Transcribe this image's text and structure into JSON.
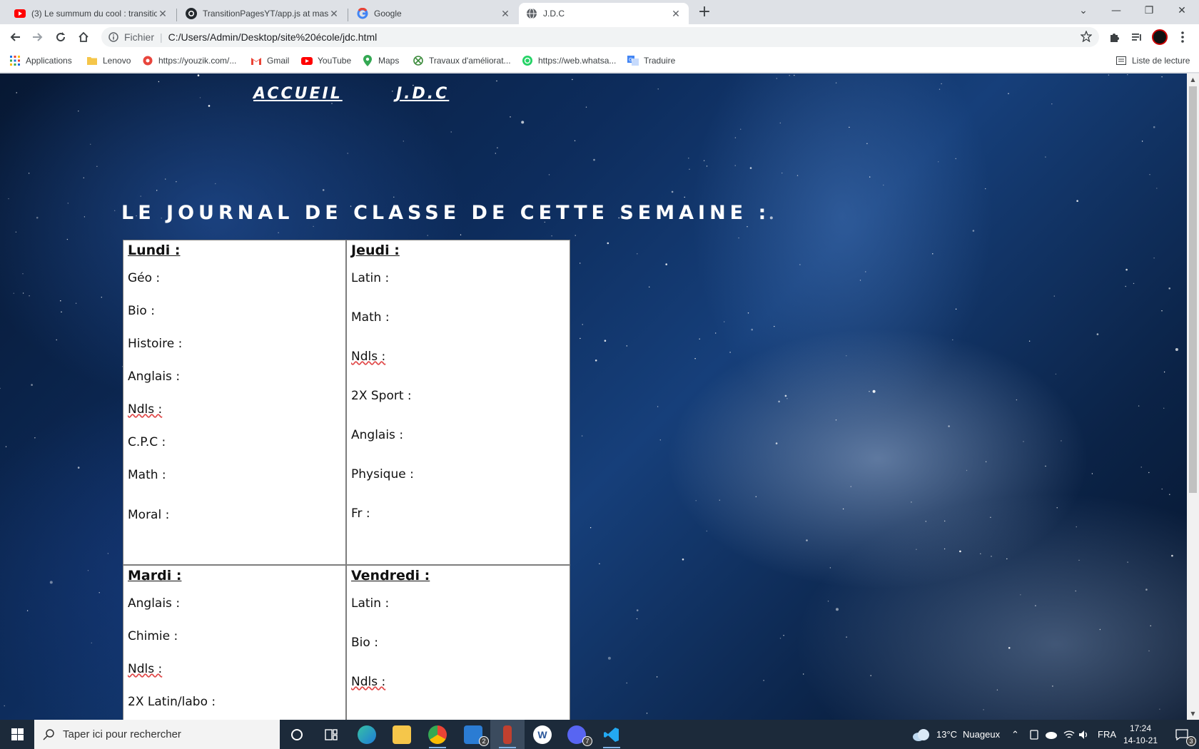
{
  "browser": {
    "tabs": [
      {
        "title": "(3) Le summum du cool : transitio",
        "favicon": "youtube-icon",
        "color": "#ff0000",
        "active": false
      },
      {
        "title": "TransitionPagesYT/app.js at mast",
        "favicon": "github-icon",
        "color": "#24292e",
        "active": false
      },
      {
        "title": "Google",
        "favicon": "google-icon",
        "color": "#4285f4",
        "active": false
      },
      {
        "title": "J.D.C",
        "favicon": "globe-icon",
        "color": "#5f6368",
        "active": true
      }
    ],
    "address": {
      "scheme_label": "Fichier",
      "url": "C:/Users/Admin/Desktop/site%20école/jdc.html"
    },
    "bookmarks": [
      {
        "label": "Applications",
        "icon": "apps-grid-icon"
      },
      {
        "label": "Lenovo",
        "icon": "folder-icon"
      },
      {
        "label": "https://youzik.com/...",
        "icon": "youzik-icon"
      },
      {
        "label": "Gmail",
        "icon": "gmail-icon"
      },
      {
        "label": "YouTube",
        "icon": "youtube-icon"
      },
      {
        "label": "Maps",
        "icon": "maps-pin-icon"
      },
      {
        "label": "Travaux d'améliorat...",
        "icon": "xbox-icon"
      },
      {
        "label": "https://web.whatsa...",
        "icon": "whatsapp-icon"
      },
      {
        "label": "Traduire",
        "icon": "translate-icon"
      }
    ],
    "reading_list_label": "Liste de lecture"
  },
  "page": {
    "nav": {
      "home": "ACCUEIL",
      "jdc": "J.D.C"
    },
    "title": "LE JOURNAL DE CLASSE DE CETTE SEMAINE :",
    "journal": {
      "lundi": {
        "day": "Lundi :",
        "subjects": [
          "Géo :",
          "Bio :",
          "Histoire :",
          "Anglais :",
          "Ndls :",
          "C.P.C :",
          "Math :",
          "Moral :"
        ]
      },
      "jeudi": {
        "day": "Jeudi :",
        "subjects": [
          "Latin :",
          "Math :",
          "Ndls :",
          "2X Sport :",
          "Anglais :",
          "Physique :",
          "Fr :"
        ]
      },
      "mardi": {
        "day": "Mardi :",
        "subjects": [
          "Anglais :",
          "Chimie :",
          "Ndls :",
          "2X Latin/labo :"
        ]
      },
      "vendredi": {
        "day": "Vendredi :",
        "subjects": [
          "Latin :",
          "Bio :",
          "Ndls :"
        ]
      }
    }
  },
  "taskbar": {
    "search_placeholder": "Taper ici pour rechercher",
    "weather": {
      "temp": "13°C",
      "condition": "Nuageux"
    },
    "language": "FRA",
    "time": "17:24",
    "date": "14-10-21",
    "mail_badge": "2",
    "discord_badge": "7",
    "notifications_badge": "3"
  }
}
